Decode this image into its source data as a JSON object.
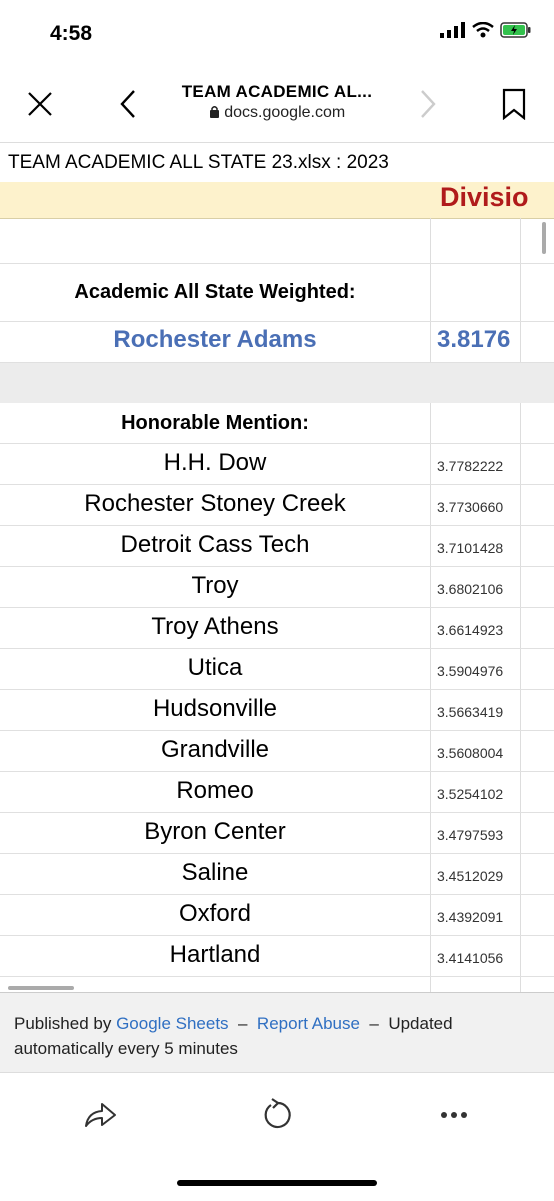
{
  "status_bar": {
    "time": "4:58"
  },
  "nav": {
    "title": "TEAM ACADEMIC AL...",
    "url": "docs.google.com"
  },
  "document": {
    "title": "TEAM ACADEMIC ALL STATE 23.xlsx : 2023"
  },
  "sheet": {
    "division_header": "Divisio",
    "weighted_heading": "Academic All State Weighted:",
    "winner": {
      "name": "Rochester Adams",
      "value": "3.8176"
    },
    "honorable_heading": "Honorable Mention:",
    "rows": [
      {
        "name": "H.H. Dow",
        "value": "3.7782222"
      },
      {
        "name": "Rochester Stoney Creek",
        "value": "3.7730660"
      },
      {
        "name": "Detroit Cass Tech",
        "value": "3.7101428"
      },
      {
        "name": "Troy",
        "value": "3.6802106"
      },
      {
        "name": "Troy Athens",
        "value": "3.6614923"
      },
      {
        "name": "Utica",
        "value": "3.5904976"
      },
      {
        "name": "Hudsonville",
        "value": "3.5663419"
      },
      {
        "name": "Grandville",
        "value": "3.5608004"
      },
      {
        "name": "Romeo",
        "value": "3.5254102"
      },
      {
        "name": "Byron Center",
        "value": "3.4797593"
      },
      {
        "name": "Saline",
        "value": "3.4512029"
      },
      {
        "name": "Oxford",
        "value": "3.4392091"
      },
      {
        "name": "Hartland",
        "value": "3.4141056"
      }
    ]
  },
  "footer": {
    "published_by": "Published by",
    "google_sheets": "Google Sheets",
    "dash1": "–",
    "report_abuse": "Report Abuse",
    "dash2": "–",
    "updated": "Updated automatically every 5 minutes"
  },
  "colors": {
    "division_red": "#b01b1b",
    "link_blue": "#2f6fc2",
    "winner_blue": "#4a6fb5"
  },
  "icons": [
    "close-icon",
    "back-icon",
    "forward-icon",
    "bookmark-icon",
    "share-icon",
    "refresh-icon",
    "more-icon"
  ]
}
